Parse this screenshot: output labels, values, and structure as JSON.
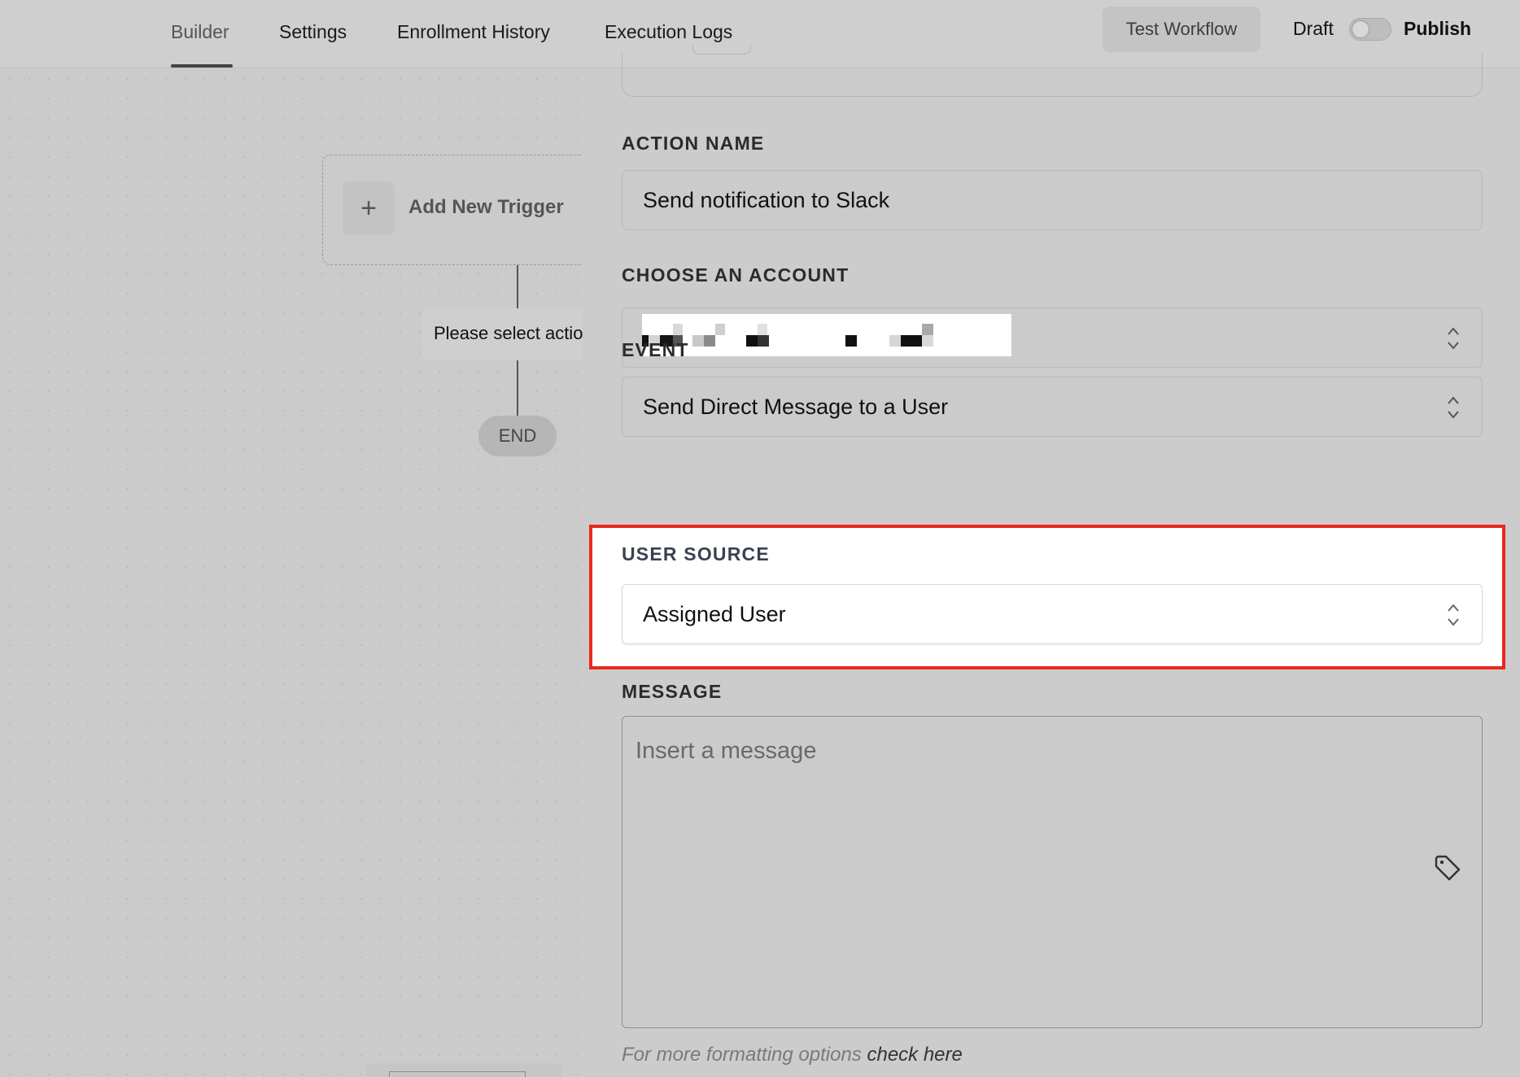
{
  "nav": {
    "tabs": [
      {
        "label": "Builder"
      },
      {
        "label": "Settings"
      },
      {
        "label": "Enrollment History"
      },
      {
        "label": "Execution Logs"
      }
    ]
  },
  "header": {
    "test_button": "Test Workflow",
    "draft_label": "Draft",
    "publish_label": "Publish",
    "publish_toggle_on": false
  },
  "canvas": {
    "trigger_label": "Add New Trigger",
    "trigger_icon": "plus-icon",
    "action_chip": "Please select action",
    "end_label": "END"
  },
  "form": {
    "action_name": {
      "label": "ACTION NAME",
      "value": "Send notification to Slack"
    },
    "account": {
      "label": "CHOOSE AN ACCOUNT"
    },
    "event": {
      "label": "EVENT",
      "value": "Send Direct Message to a User"
    },
    "user_source": {
      "label": "USER SOURCE",
      "value": "Assigned User"
    },
    "message": {
      "label": "MESSAGE",
      "placeholder": "Insert a message"
    },
    "helper_text": "For more formatting options",
    "helper_link": "check here"
  },
  "colors": {
    "highlight_border": "#e8291c"
  }
}
